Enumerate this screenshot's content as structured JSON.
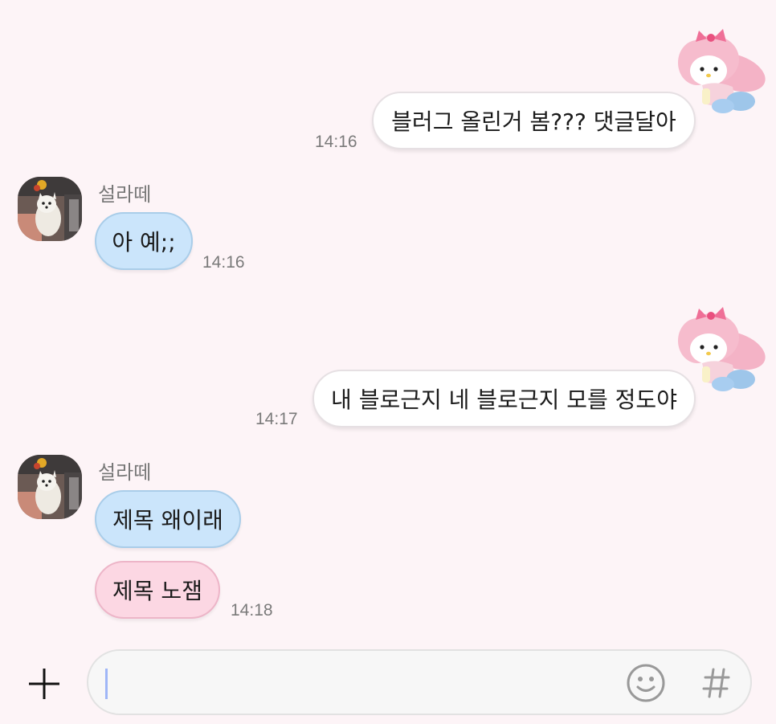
{
  "messages": {
    "m1": {
      "text": "블러그 올린거 봄??? 댓글달아",
      "time": "14:16"
    },
    "m2": {
      "sender": "설라떼",
      "text": "아 예;;",
      "time": "14:16"
    },
    "m3": {
      "text": "내 블로근지 네 블로근지 모를 정도야",
      "time": "14:17"
    },
    "m4": {
      "sender": "설라떼",
      "texts": [
        "제목 왜이래",
        "제목 노잼"
      ],
      "time": "14:18"
    }
  },
  "input": {
    "value": "",
    "placeholder": ""
  },
  "icons": {
    "add": "plus-icon",
    "emoji": "emoji-icon",
    "hashtag": "hashtag-icon",
    "sticker": "my-melody-sticker",
    "avatar": "dog-avatar"
  },
  "colors": {
    "background": "#fdf4f7",
    "incoming_blue": "#cbe5fb",
    "incoming_pink": "#fcd7e3",
    "outgoing": "#ffffff",
    "caret": "#9fb6f7"
  }
}
